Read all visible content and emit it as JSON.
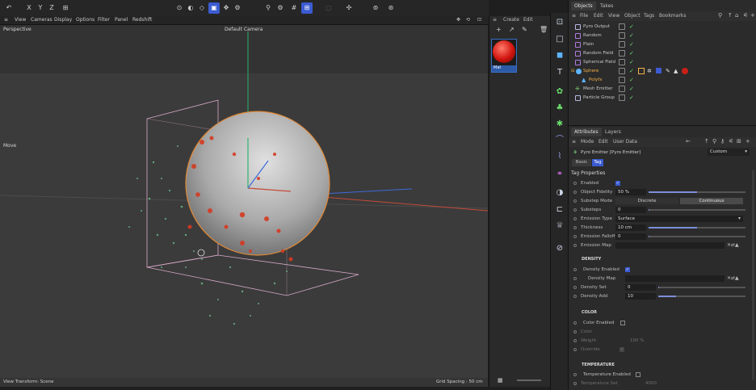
{
  "toolbar": {
    "icons": [
      "undo-icon",
      "redo-icon",
      "x-axis-icon",
      "y-axis-icon",
      "z-axis-icon",
      "coordinate-icon",
      "render-icon",
      "render-view-icon",
      "render-settings-icon",
      "snap-icon",
      "grid-icon"
    ]
  },
  "viewport_menu": {
    "items": [
      "View",
      "Cameras",
      "Display",
      "Options",
      "Filter",
      "Panel",
      "Redshift"
    ]
  },
  "viewport": {
    "label": "Perspective",
    "camera": "Default Camera",
    "tool": "Move",
    "footer_left": "View Transform: Scene",
    "footer_right": "Grid Spacing : 50 cm"
  },
  "material_panel": {
    "menu": [
      "Create",
      "Edit"
    ],
    "material_name": "Mat"
  },
  "objects_panel": {
    "tabs": [
      "Objects",
      "Takes"
    ],
    "menu": [
      "File",
      "Edit",
      "View",
      "Object",
      "Tags",
      "Bookmarks"
    ],
    "rows": [
      {
        "name": "Pyro Output",
        "indent": 0
      },
      {
        "name": "Random",
        "indent": 0
      },
      {
        "name": "Plain",
        "indent": 0
      },
      {
        "name": "Random Field",
        "indent": 0
      },
      {
        "name": "Spherical Field",
        "indent": 0
      },
      {
        "name": "Sphere",
        "indent": 0,
        "selected": true
      },
      {
        "name": "Polyfx",
        "indent": 1
      },
      {
        "name": "Mesh Emitter",
        "indent": 0
      },
      {
        "name": "Particle Group",
        "indent": 0
      }
    ]
  },
  "attributes": {
    "tabs": [
      "Attributes",
      "Layers"
    ],
    "menu": [
      "Mode",
      "Edit",
      "User Data"
    ],
    "mode_select": "Custom",
    "title": "Pyro Emitter [Pyro Emitter]",
    "subtabs": [
      "Basic",
      "Tag"
    ],
    "section_title": "Tag Properties",
    "enabled_label": "Enabled",
    "object_fidelity": {
      "label": "Object Fidelity",
      "value": "50 %",
      "fill": 0.5
    },
    "substep_mode": {
      "label": "Substep Mode",
      "options": [
        "Discrete",
        "Continuous"
      ],
      "selected": "Continuous"
    },
    "substeps": {
      "label": "Substeps",
      "value": "0"
    },
    "emission_type": {
      "label": "Emission Type",
      "value": "Surface"
    },
    "thickness": {
      "label": "Thickness",
      "value": "10 cm",
      "fill": 0.5
    },
    "emission_falloff": {
      "label": "Emission Falloff",
      "value": "0"
    },
    "emission_map": {
      "label": "Emission Map"
    },
    "density": {
      "header": "DENSITY",
      "enabled_label": "Density Enabled",
      "map_label": "Density Map",
      "set_label": "Density Set",
      "set_value": "0",
      "add_label": "Density Add",
      "add_value": "10"
    },
    "color": {
      "header": "COLOR",
      "enabled_label": "Color Enabled",
      "color_label": "Color",
      "weight_label": "Weight",
      "weight_value": "100 %",
      "override_label": "Override"
    },
    "temperature": {
      "header": "TEMPERATURE",
      "enabled_label": "Temperature Enabled",
      "set_label": "Temperature Set",
      "set_value": "4000"
    }
  }
}
